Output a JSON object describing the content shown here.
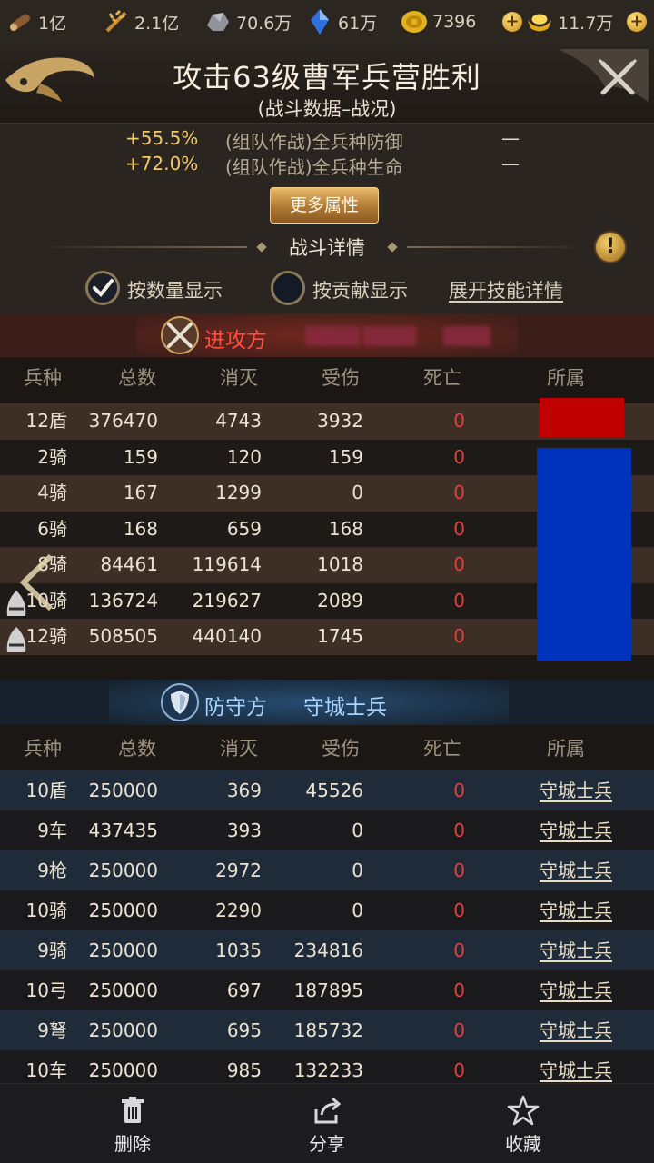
{
  "resources": [
    {
      "icon": "wood-icon",
      "value": "1亿"
    },
    {
      "icon": "food-icon",
      "value": "2.1亿"
    },
    {
      "icon": "stone-icon",
      "value": "70.6万"
    },
    {
      "icon": "crystal-icon",
      "value": "61万"
    },
    {
      "icon": "coin-icon",
      "value": "7396"
    },
    {
      "icon": "gold-ingot-icon",
      "value": "11.7万"
    }
  ],
  "header": {
    "title": "攻击63级曹军兵营胜利",
    "subtitle": "(战斗数据–战况)"
  },
  "attributes": [
    {
      "pct": "+55.5%",
      "name": "(组队作战)全兵种防御",
      "dash": "—"
    },
    {
      "pct": "+72.0%",
      "name": "(组队作战)全兵种生命",
      "dash": "—"
    }
  ],
  "more_button": "更多属性",
  "battle_section_title": "战斗详情",
  "display_options": {
    "by_count": "按数量显示",
    "by_contribution": "按贡献显示",
    "expand_skills": "展开技能详情"
  },
  "attacker": {
    "label": "进攻方",
    "columns": [
      "兵种",
      "总数",
      "消灭",
      "受伤",
      "死亡",
      "所属"
    ],
    "rows": [
      {
        "unit": "12盾",
        "total": "376470",
        "kills": "4743",
        "wounded": "3932",
        "dead": "0"
      },
      {
        "unit": "2骑",
        "total": "159",
        "kills": "120",
        "wounded": "159",
        "dead": "0"
      },
      {
        "unit": "4骑",
        "total": "167",
        "kills": "1299",
        "wounded": "0",
        "dead": "0"
      },
      {
        "unit": "6骑",
        "total": "168",
        "kills": "659",
        "wounded": "168",
        "dead": "0"
      },
      {
        "unit": "8骑",
        "total": "84461",
        "kills": "119614",
        "wounded": "1018",
        "dead": "0"
      },
      {
        "unit": "10骑",
        "total": "136724",
        "kills": "219627",
        "wounded": "2089",
        "dead": "0"
      },
      {
        "unit": "12骑",
        "total": "508505",
        "kills": "440140",
        "wounded": "1745",
        "dead": "0"
      }
    ]
  },
  "defender": {
    "label": "防守方",
    "name": "守城士兵",
    "columns": [
      "兵种",
      "总数",
      "消灭",
      "受伤",
      "死亡",
      "所属"
    ],
    "rows": [
      {
        "unit": "10盾",
        "total": "250000",
        "kills": "369",
        "wounded": "45526",
        "dead": "0",
        "owner": "守城士兵"
      },
      {
        "unit": "9车",
        "total": "437435",
        "kills": "393",
        "wounded": "0",
        "dead": "0",
        "owner": "守城士兵"
      },
      {
        "unit": "9枪",
        "total": "250000",
        "kills": "2972",
        "wounded": "0",
        "dead": "0",
        "owner": "守城士兵"
      },
      {
        "unit": "10骑",
        "total": "250000",
        "kills": "2290",
        "wounded": "0",
        "dead": "0",
        "owner": "守城士兵"
      },
      {
        "unit": "9骑",
        "total": "250000",
        "kills": "1035",
        "wounded": "234816",
        "dead": "0",
        "owner": "守城士兵"
      },
      {
        "unit": "10弓",
        "total": "250000",
        "kills": "697",
        "wounded": "187895",
        "dead": "0",
        "owner": "守城士兵"
      },
      {
        "unit": "9弩",
        "total": "250000",
        "kills": "695",
        "wounded": "185732",
        "dead": "0",
        "owner": "守城士兵"
      },
      {
        "unit": "10车",
        "total": "250000",
        "kills": "985",
        "wounded": "132233",
        "dead": "0",
        "owner": "守城士兵"
      }
    ]
  },
  "bottom_bar": {
    "delete": "删除",
    "share": "分享",
    "favorite": "收藏"
  },
  "colors": {
    "dead_value": "#e04040",
    "attacker_label": "#ff5040",
    "defender_label": "#a9d6ff",
    "owner_red": "#c00000",
    "owner_blue": "#0033bb"
  }
}
